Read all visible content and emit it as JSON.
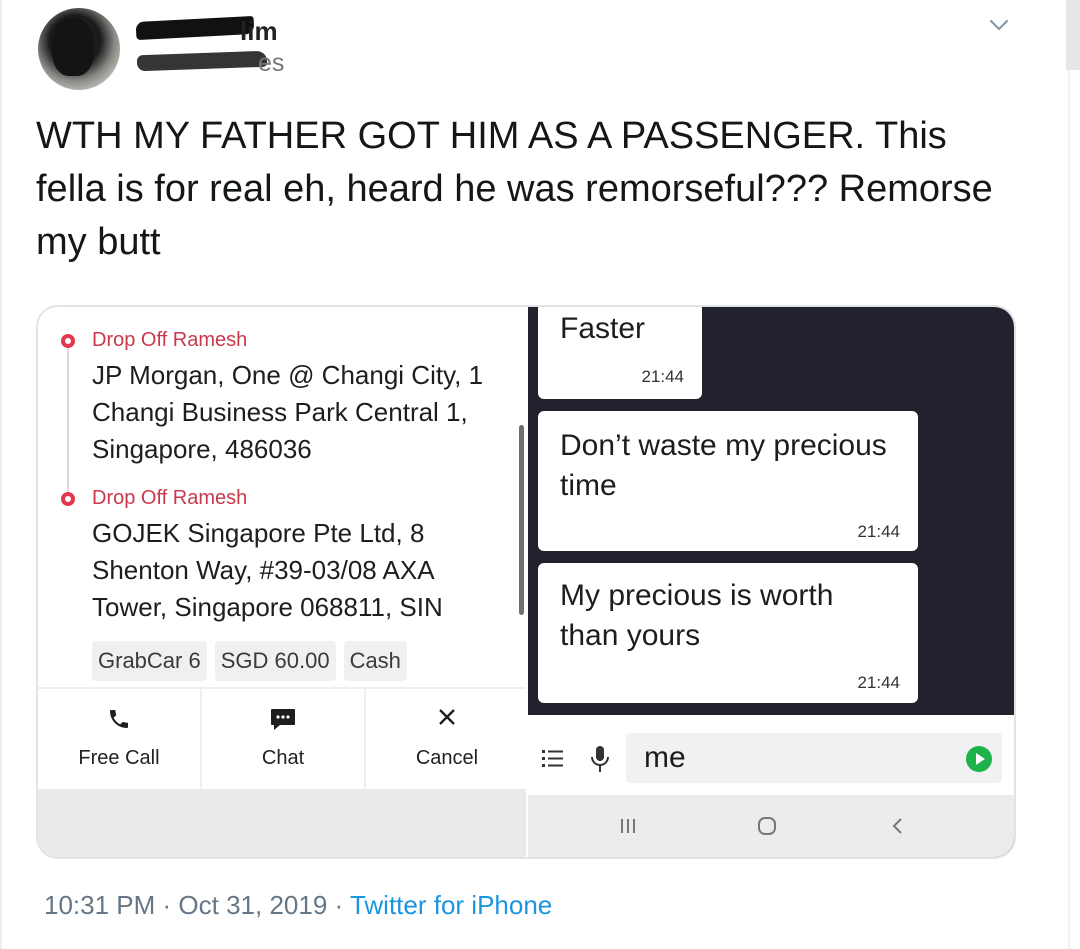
{
  "tweet": {
    "display_name_visible": "lim",
    "handle_visible": "es",
    "text": "WTH MY FATHER GOT HIM AS A PASSENGER. This fella is for real eh, heard he was remorseful??? Remorse my butt",
    "footer": {
      "time": "10:31 PM",
      "separator": " · ",
      "date": "Oct 31, 2019",
      "source": "Twitter for iPhone"
    }
  },
  "ride": {
    "stops": [
      {
        "label": "Drop Off Ramesh",
        "address": "JP Morgan, One @ Changi City, 1 Changi Business Park Central 1, Singapore, 486036"
      },
      {
        "label": "Drop Off Ramesh",
        "address": "GOJEK Singapore Pte Ltd, 8 Shenton Way, #39-03/08 AXA Tower, Singapore 068811, SIN"
      }
    ],
    "chips": [
      "GrabCar 6",
      "SGD 60.00",
      "Cash"
    ],
    "actions": [
      {
        "label": "Free Call",
        "icon": "phone-icon"
      },
      {
        "label": "Chat",
        "icon": "chat-bubble-icon"
      },
      {
        "label": "Cancel",
        "icon": "close-icon"
      }
    ]
  },
  "chat": {
    "messages": [
      {
        "text": "Faster",
        "time": "21:44"
      },
      {
        "text": "Don’t waste my precious time",
        "time": "21:44"
      },
      {
        "text": "My precious is worth than yours",
        "time": "21:44"
      }
    ],
    "input_value": "me",
    "colors": {
      "background": "#22222f",
      "send": "#1cb34a"
    }
  },
  "colors": {
    "drop_label": "#c8394c",
    "link": "#1b95e0"
  },
  "nav_icons": [
    "recents-icon",
    "home-icon",
    "back-icon"
  ]
}
